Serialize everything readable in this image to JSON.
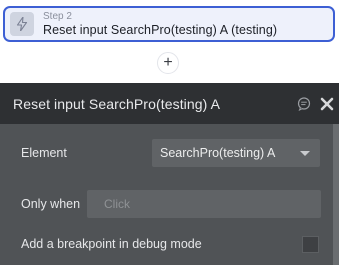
{
  "step": {
    "number_label": "Step 2",
    "title": "Reset input SearchPro(testing) A (testing)",
    "icon": "lightning-bolt-icon"
  },
  "add_step": {
    "label": "+"
  },
  "panel": {
    "title": "Reset input SearchPro(testing) A",
    "comment_icon": "comment-icon",
    "close_icon": "close-icon",
    "element_label": "Element",
    "element_value": "SearchPro(testing) A",
    "only_when_label": "Only when",
    "only_when_placeholder": "Click",
    "breakpoint_label": "Add a breakpoint in debug mode"
  },
  "colors": {
    "accent": "#3d5fd4",
    "panel_bg": "#505356",
    "panel_header_bg": "#2e3033"
  }
}
